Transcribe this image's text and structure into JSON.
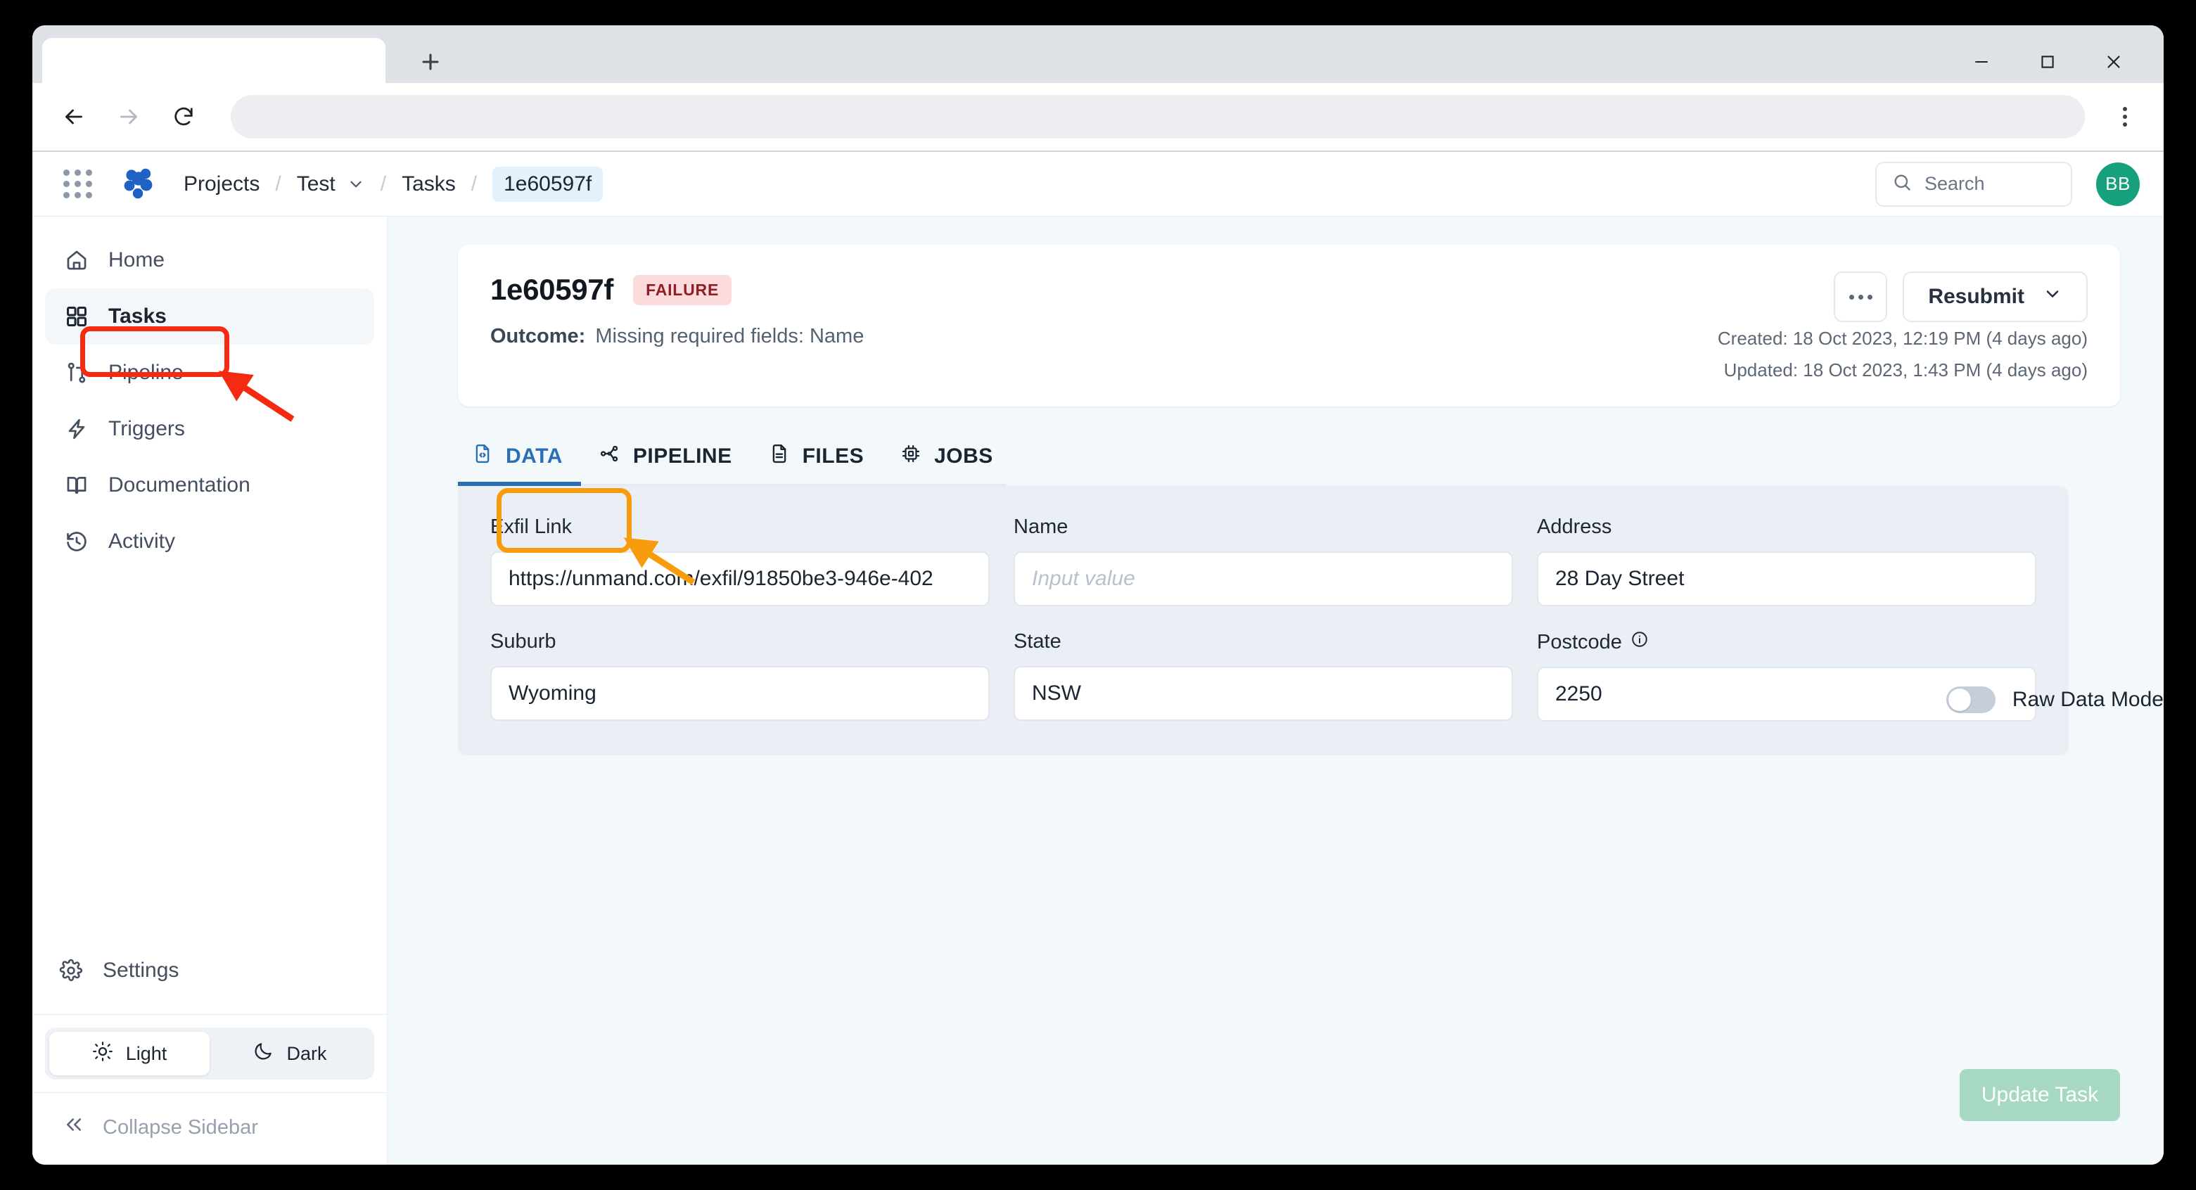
{
  "browser": {
    "tab_title": "",
    "new_tab_label": "+",
    "url_value": "",
    "nav": {
      "back": "back-arrow",
      "forward": "forward-arrow",
      "reload": "reload-arrow"
    },
    "window_controls": {
      "minimize": "minimize",
      "maximize": "maximize",
      "close": "close"
    },
    "menu": "browser-menu"
  },
  "appbar": {
    "apps_grid": "apps-grid-icon",
    "logo": "unmand-hex-logo",
    "breadcrumb": {
      "projects": "Projects",
      "project": "Test",
      "tasks": "Tasks",
      "current": "1e60597f",
      "separator": "/"
    },
    "search": {
      "placeholder": "Search",
      "icon": "search-icon"
    },
    "avatar": {
      "initials": "BB",
      "color": "#16a07c"
    }
  },
  "sidebar": {
    "items": [
      {
        "label": "Home",
        "icon": "home-icon",
        "active": false
      },
      {
        "label": "Tasks",
        "icon": "grid-squares-icon",
        "active": true
      },
      {
        "label": "Pipeline",
        "icon": "pipeline-branch-icon",
        "active": false
      },
      {
        "label": "Triggers",
        "icon": "lightning-bolt-icon",
        "active": false
      },
      {
        "label": "Documentation",
        "icon": "book-icon",
        "active": false
      },
      {
        "label": "Activity",
        "icon": "clock-rewind-icon",
        "active": false
      }
    ],
    "settings": {
      "label": "Settings",
      "icon": "gear-icon"
    },
    "theme": {
      "light": "Light",
      "dark": "Dark",
      "selected": "Light",
      "light_icon": "sun-icon",
      "dark_icon": "moon-icon"
    },
    "collapse": {
      "label": "Collapse Sidebar",
      "icon": "double-chevron-left-icon"
    }
  },
  "task": {
    "id": "1e60597f",
    "status": "FAILURE",
    "status_color": "#8f1f27",
    "status_bg": "#fcdbdd",
    "outcome_label": "Outcome:",
    "outcome_value": "Missing required fields: Name",
    "actions": {
      "more": "…",
      "resubmit": "Resubmit",
      "resubmit_chevron": "chevron-down-icon"
    },
    "created": "Created: 18 Oct 2023, 12:19 PM (4 days ago)",
    "updated": "Updated: 18 Oct 2023, 1:43 PM (4 days ago)"
  },
  "tabs": [
    {
      "label": "DATA",
      "icon": "file-code-icon",
      "active": true
    },
    {
      "label": "PIPELINE",
      "icon": "network-nodes-icon",
      "active": false
    },
    {
      "label": "FILES",
      "icon": "file-lines-icon",
      "active": false
    },
    {
      "label": "JOBS",
      "icon": "cpu-chip-icon",
      "active": false
    }
  ],
  "raw_data_mode": {
    "label": "Raw Data Mode",
    "enabled": false
  },
  "form": {
    "fields": [
      {
        "label": "Exfil Link",
        "value": "https://unmand.com/exfil/91850be3-946e-402",
        "placeholder": "",
        "info": false
      },
      {
        "label": "Name",
        "value": "",
        "placeholder": "Input value",
        "info": false
      },
      {
        "label": "Address",
        "value": "28 Day Street",
        "placeholder": "",
        "info": false
      },
      {
        "label": "Suburb",
        "value": "Wyoming",
        "placeholder": "",
        "info": false
      },
      {
        "label": "State",
        "value": "NSW",
        "placeholder": "",
        "info": false
      },
      {
        "label": "Postcode",
        "value": "2250",
        "placeholder": "",
        "info": true
      }
    ]
  },
  "update_button": {
    "label": "Update Task",
    "disabled": true,
    "color": "#a7d8c2"
  },
  "annotations": [
    {
      "target": "sidebar-item-tasks",
      "shape": "rounded-rect",
      "color": "#f42b10"
    },
    {
      "target": "tab-data",
      "shape": "rounded-rect",
      "color": "#f79c0c"
    }
  ]
}
